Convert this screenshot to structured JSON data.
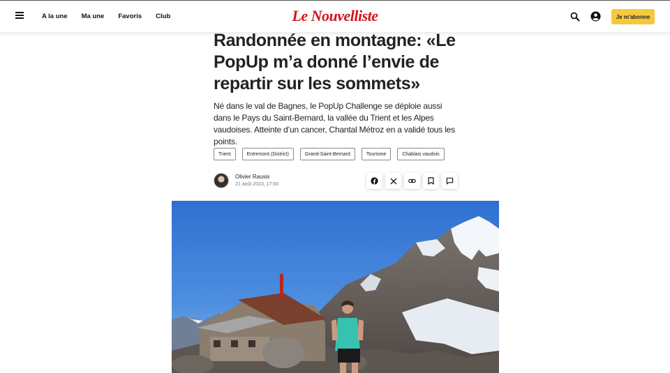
{
  "header": {
    "nav": [
      "A la une",
      "Ma une",
      "Favoris",
      "Club"
    ],
    "logo": "Le Nouvelliste",
    "subscribe_label": "Je m'abonne"
  },
  "article": {
    "title": "Randonnée en montagne: «Le PopUp m’a donné l’envie de repartir sur les sommets»",
    "lead": "Né dans le val de Bagnes, le PopUp Challenge se déploie aussi dans le Pays du Saint-Bernard, la vallée du Trient et les Alpes vaudoises. Atteinte d’un cancer, Chantal Métroz en a validé tous les points.",
    "tags": [
      "Trient",
      "Entremont (District)",
      "Grand-Saint-Bernard",
      "Tourisme",
      "Chablais vaudois"
    ],
    "author": "Olivier Rausis",
    "date": "21 août 2023, 17:00"
  },
  "icons": {
    "menu": "menu-icon",
    "search": "search-icon",
    "account": "account-icon",
    "share": [
      "facebook-icon",
      "x-icon",
      "link-icon",
      "bookmark-icon",
      "comment-icon"
    ]
  },
  "colors": {
    "logo": "#d4141b",
    "subscribe_button": "#f6c83b"
  }
}
